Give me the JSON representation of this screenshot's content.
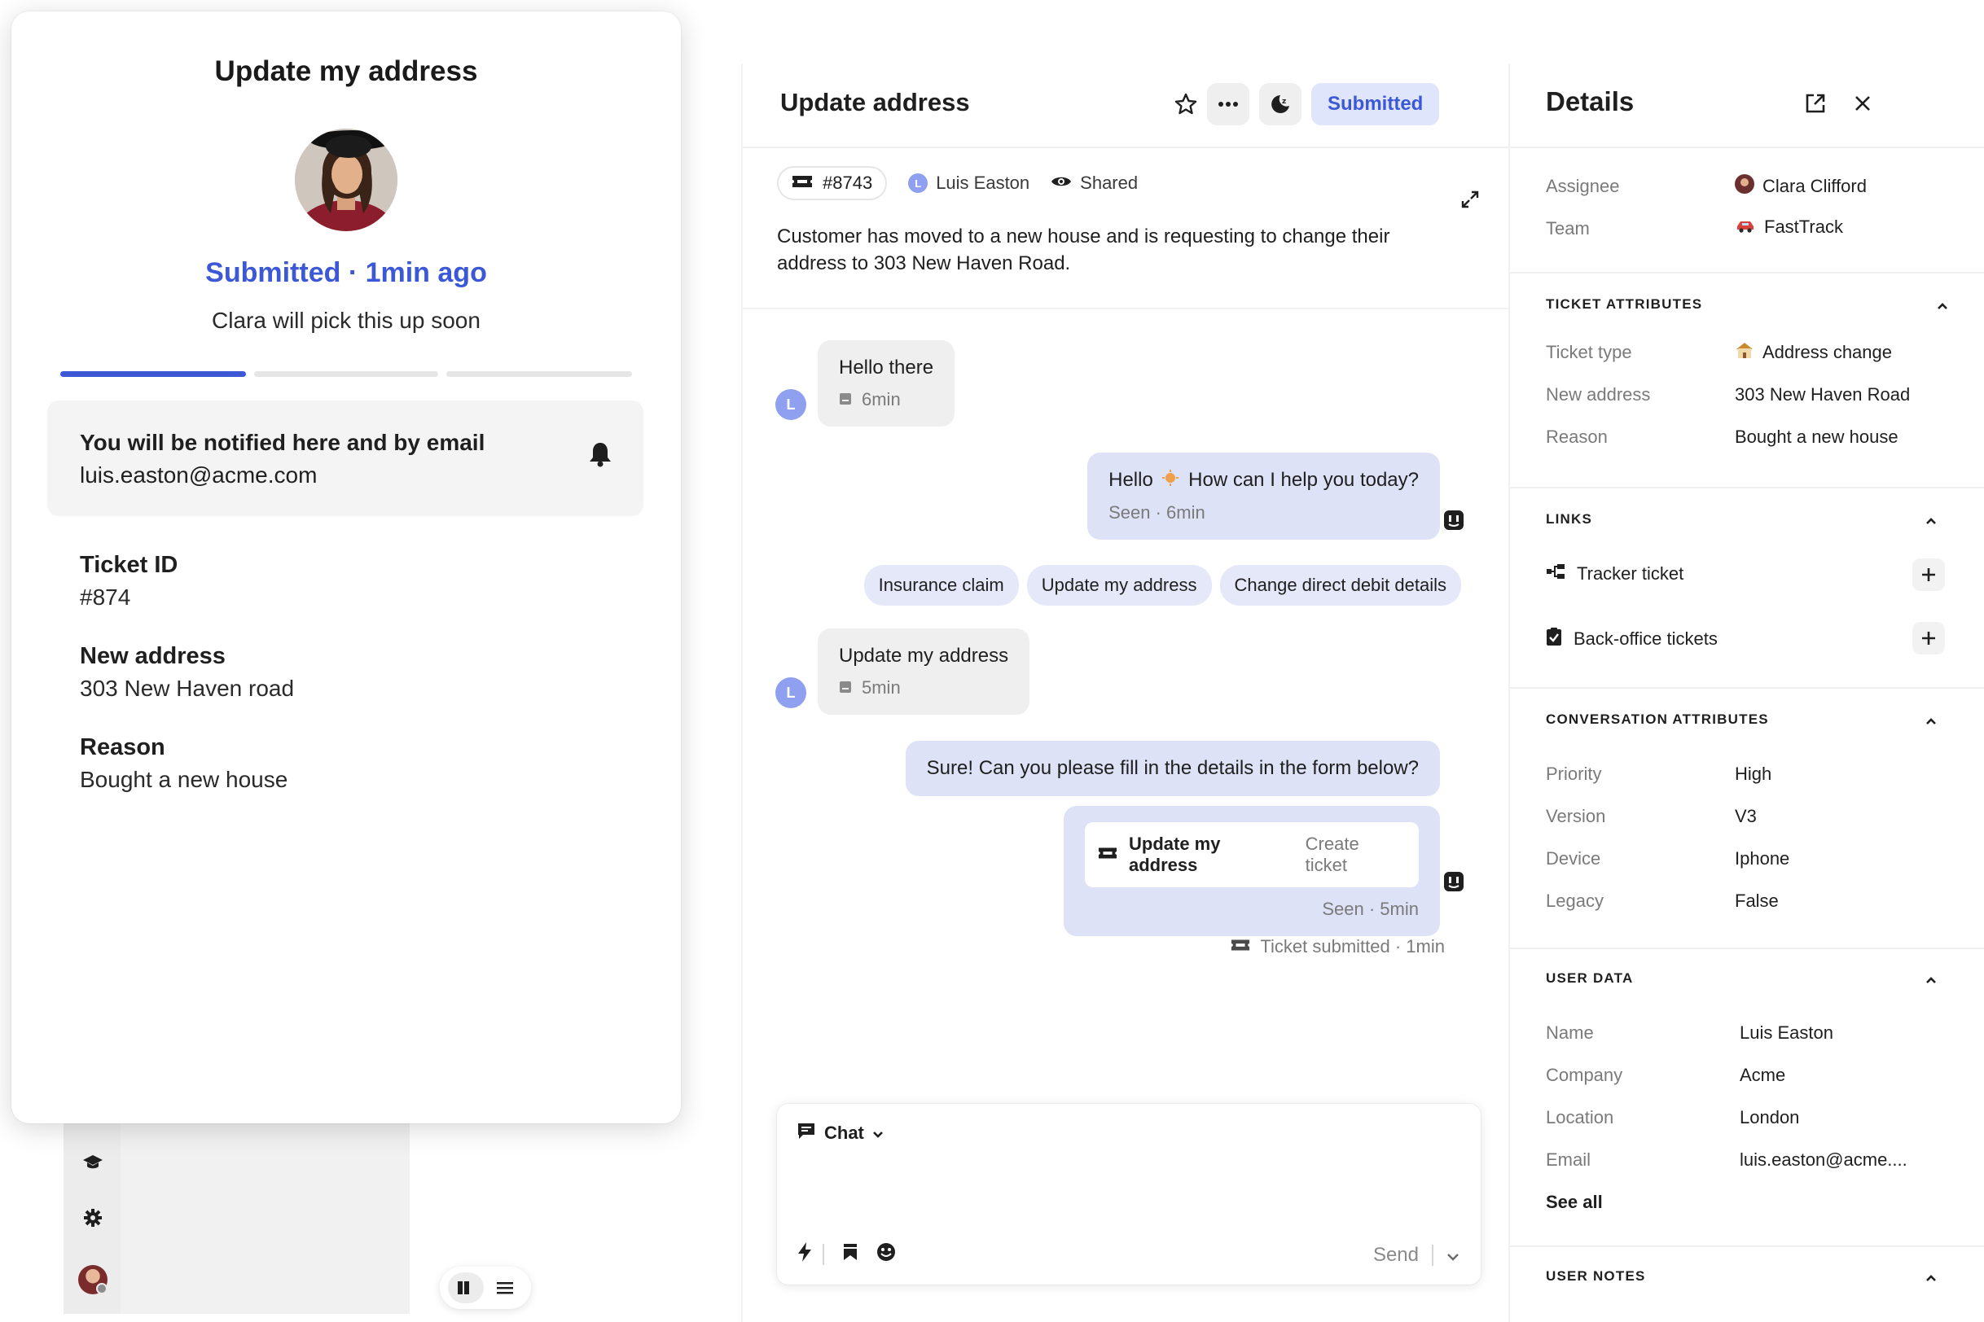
{
  "messenger": {
    "title": "Update my address",
    "status": "Submitted · 1min ago",
    "subtitle": "Clara will pick this up soon",
    "progress_steps": 3,
    "progress_completed": 1,
    "notify_title": "You will be notified here and by email",
    "notify_email": "luis.easton@acme.com",
    "fields": [
      {
        "label": "Ticket ID",
        "value": "#874"
      },
      {
        "label": "New address",
        "value": "303 New Haven road"
      },
      {
        "label": "Reason",
        "value": "Bought a new house"
      }
    ],
    "accent_color": "#3c58d6"
  },
  "rail": {
    "icons": [
      "graduation-cap-icon",
      "gear-icon",
      "user-avatar"
    ]
  },
  "view_toggle": {
    "options": [
      "columns-icon",
      "list-icon"
    ],
    "active": "columns-icon"
  },
  "conversation": {
    "title": "Update address",
    "status_button": "Submitted",
    "ticket_id": "#8743",
    "customer": "Luis Easton",
    "customer_initial": "L",
    "visibility": "Shared",
    "description": "Customer has moved to a new house and is requesting to change their address to 303 New Haven Road.",
    "messages": [
      {
        "direction": "in",
        "text": "Hello there",
        "meta": "6min"
      },
      {
        "direction": "out",
        "text_before": "Hello",
        "text_after": "How can I help you today?",
        "meta": "Seen · 6min"
      },
      {
        "direction": "in",
        "text": "Update my address",
        "meta": "5min"
      },
      {
        "direction": "out",
        "text": "Sure! Can you please fill in the details in the form below?"
      }
    ],
    "quick_replies": [
      "Insurance claim",
      "Update my address",
      "Change direct debit details"
    ],
    "ticket_card": {
      "name": "Update my address",
      "action": "Create ticket",
      "meta": "Seen · 5min"
    },
    "system_event": "Ticket submitted · 1min",
    "composer": {
      "mode": "Chat",
      "send_label": "Send"
    }
  },
  "details": {
    "title": "Details",
    "assignee_label": "Assignee",
    "assignee_value": "Clara Clifford",
    "team_label": "Team",
    "team_value": "FastTrack",
    "ticket_attributes_title": "TICKET ATTRIBUTES",
    "ticket_attributes": [
      {
        "label": "Ticket type",
        "value": "Address change"
      },
      {
        "label": "New address",
        "value": "303 New Haven Road"
      },
      {
        "label": "Reason",
        "value": "Bought a new house"
      }
    ],
    "links_title": "LINKS",
    "links": [
      "Tracker ticket",
      "Back-office tickets"
    ],
    "conversation_attributes_title": "CONVERSATION ATTRIBUTES",
    "conversation_attributes": [
      {
        "label": "Priority",
        "value": "High"
      },
      {
        "label": "Version",
        "value": "V3"
      },
      {
        "label": "Device",
        "value": "Iphone"
      },
      {
        "label": "Legacy",
        "value": "False"
      }
    ],
    "user_data_title": "USER DATA",
    "user_data": [
      {
        "label": "Name",
        "value": "Luis Easton"
      },
      {
        "label": "Company",
        "value": "Acme"
      },
      {
        "label": "Location",
        "value": "London"
      },
      {
        "label": "Email",
        "value": "luis.easton@acme...."
      }
    ],
    "see_all": "See all",
    "user_notes_title": "USER NOTES"
  }
}
